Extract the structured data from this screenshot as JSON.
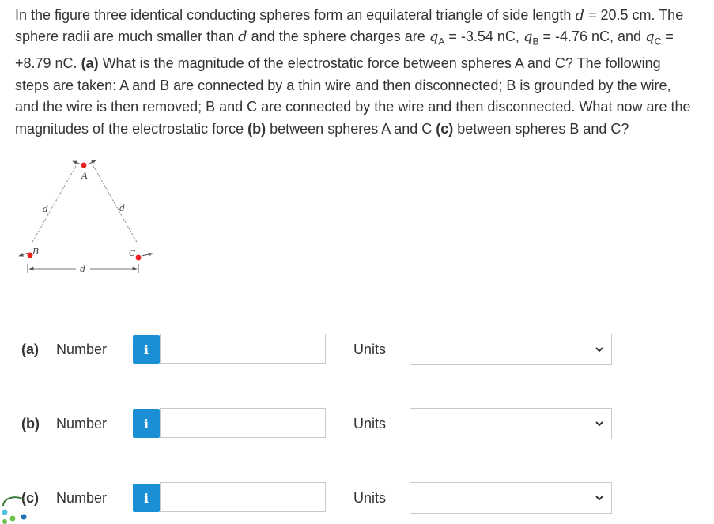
{
  "problem": {
    "t1": "In the figure three identical conducting spheres form an equilateral triangle of side length ",
    "d_sym": "d",
    "t2": " = 20.5 cm. The sphere radii are much smaller than ",
    "t3": " and the sphere charges are ",
    "q_sym": "q",
    "sub_a": "A",
    "t4": " = -3.54 nC, ",
    "sub_b": "B",
    "t5": " = -4.76 nC, and ",
    "sub_c": "C",
    "t6": " = +8.79 nC. ",
    "part_a": "(a)",
    "t7": " What is the magnitude of the electrostatic force between spheres A and C? The following steps are taken: A and B are connected by a thin wire and then disconnected; B is grounded by the wire, and the wire is then removed; B and C are connected by the wire and then disconnected. What now are the magnitudes of the electrostatic force ",
    "part_b": "(b)",
    "t8": " between spheres A and C ",
    "part_c": "(c)",
    "t9": " between spheres B and C?"
  },
  "figure": {
    "label_a": "A",
    "label_b": "B",
    "label_c": "C",
    "label_d": "d",
    "sphere_color": "#e8231f"
  },
  "answers": [
    {
      "part": "(a)",
      "number_label": "Number",
      "info_icon": "i",
      "value": "",
      "units_label": "Units",
      "units_selected": ""
    },
    {
      "part": "(b)",
      "number_label": "Number",
      "info_icon": "i",
      "value": "",
      "units_label": "Units",
      "units_selected": ""
    },
    {
      "part": "(c)",
      "number_label": "Number",
      "info_icon": "i",
      "value": "",
      "units_label": "Units",
      "units_selected": ""
    }
  ],
  "colors": {
    "info_button": "#1a8fd6",
    "text": "#333333",
    "border": "#c9c9c9"
  }
}
